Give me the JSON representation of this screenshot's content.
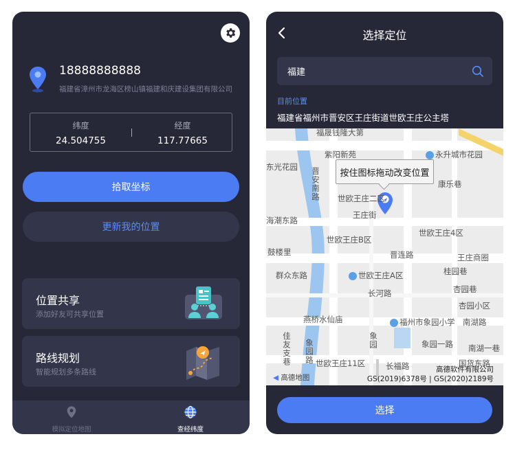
{
  "left": {
    "user": {
      "phone": "18888888888",
      "address": "福建省漳州市龙海区榜山镇福建和庆建设集团有限公司"
    },
    "coords": {
      "lat_label": "纬度",
      "lat_value": "24.504755",
      "lng_label": "经度",
      "lng_value": "117.77665"
    },
    "buttons": {
      "pick": "拾取坐标",
      "update": "更新我的位置"
    },
    "cards": [
      {
        "title": "位置共享",
        "subtitle": "添加好友可共享位置",
        "icon": "share-location-illustration"
      },
      {
        "title": "路线规划",
        "subtitle": "智能规划多条路线",
        "icon": "route-map-illustration"
      }
    ],
    "tabs": [
      {
        "label": "模拟定位地图",
        "icon": "location-pin-icon",
        "active": false
      },
      {
        "label": "查经纬度",
        "icon": "globe-icon",
        "active": true
      }
    ]
  },
  "right": {
    "title": "选择定位",
    "search": {
      "value": "福建"
    },
    "current_label": "目前位置",
    "current_address": "福建省福州市晋安区王庄街道世欧王庄公主塔",
    "map": {
      "tooltip": "按住图标拖动改变位置",
      "labels": {
        "l1": "福晟钱隆大第",
        "l2": "紫阳新苑",
        "l3": "永升城市花园",
        "l4": "东光花园",
        "l5": "晋安南路",
        "l6": "康乐巷",
        "l7": "世欧王庄二区",
        "l8": "王庄街",
        "l9": "海潮东路",
        "l10": "世欧王庄4区",
        "l11": "世欧王庄B区",
        "l12": "鼓楼里",
        "l13": "晋连路",
        "l14": "王庄商圈",
        "l15": "群众东路",
        "l16": "世欧王庄A区",
        "l17": "桂园巷",
        "l18": "杏园巷",
        "l19": "长河路",
        "l20": "杏园小区",
        "l21": "燕桥水仙庙",
        "l22": "福州市象园小学",
        "l23": "南湖路",
        "l24": "佳友支巷",
        "l25": "象园路",
        "l26": "南湖一巷",
        "l27": "世欧王庄11区",
        "l28": "国货东路",
        "l29": "长福路",
        "l30": "象园",
        "l31": "象园一路"
      },
      "brand": "高德地图",
      "copyright1": "高德软件有限公司",
      "copyright2": "GS(2019)6378号 | GS(2020)2189号"
    },
    "select_button": "选择"
  },
  "colors": {
    "background": "#262838",
    "surface": "#33364a",
    "accent": "#4c7cf3",
    "accent_text": "#5b8cf6"
  }
}
